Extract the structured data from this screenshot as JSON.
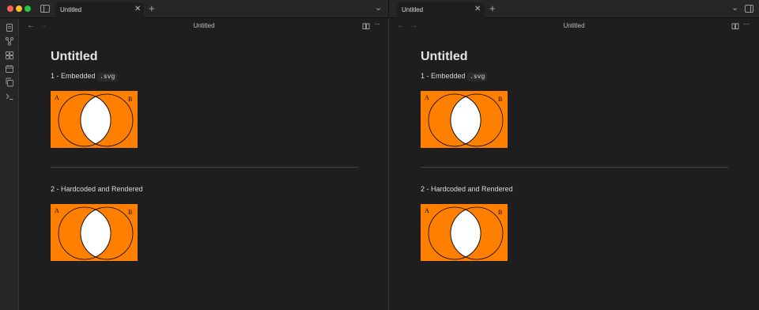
{
  "tabs": {
    "left": {
      "label": "Untitled"
    },
    "right": {
      "label": "Untitled"
    }
  },
  "panes": [
    {
      "header_title": "Untitled",
      "note_title": "Untitled",
      "section1_prefix": "1 - Embedded",
      "section1_code": ".svg",
      "section2_label": "2 - Hardcoded and Rendered"
    },
    {
      "header_title": "Untitled",
      "note_title": "Untitled",
      "section1_prefix": "1 - Embedded",
      "section1_code": ".svg",
      "section2_label": "2 - Hardcoded and Rendered"
    }
  ],
  "venn": {
    "label_a": "A",
    "label_b": "B",
    "fill_color": "#ff8000",
    "intersection_color": "#ffffff"
  },
  "icons": {
    "window": [
      "sidebar-toggle-icon",
      "new-tab-icon",
      "tab-list-chevron-icon",
      "right-sidebar-toggle-icon",
      "close-tab-icon"
    ],
    "ribbon": [
      "files-icon",
      "graph-icon",
      "canvas-icon",
      "calendar-icon",
      "copy-icon",
      "terminal-icon"
    ],
    "pane": [
      "back-arrow-icon",
      "forward-arrow-icon",
      "reading-view-icon",
      "more-options-icon"
    ]
  },
  "colors": {
    "background": "#1e1e1e",
    "titlebar": "#262626",
    "accent_orange": "#ff8000"
  }
}
